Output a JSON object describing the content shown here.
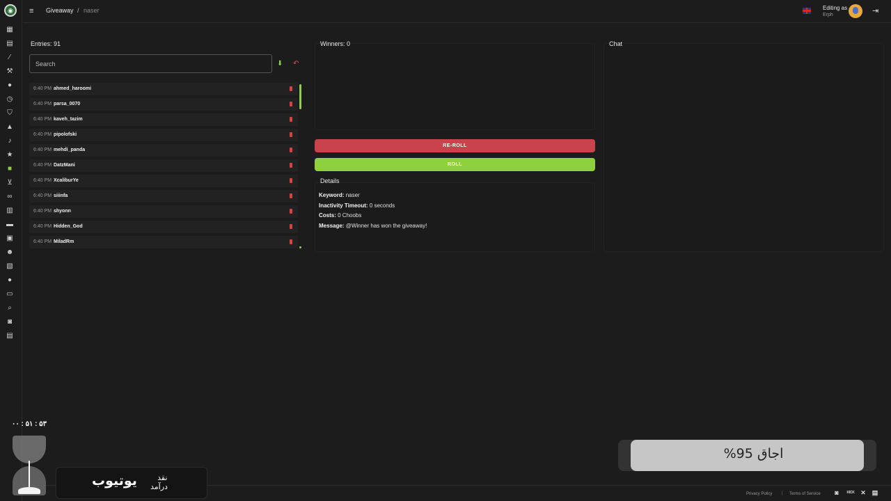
{
  "header": {
    "breadcrumb_main": "Giveaway",
    "breadcrumb_sep": "/",
    "breadcrumb_current": "naser",
    "editing_label": "Editing as",
    "editing_user": "Erph"
  },
  "sidebar": {
    "logo_icon": "channel-logo-icon",
    "items": [
      {
        "icon": "dashboard-icon",
        "glyph": "▦"
      },
      {
        "icon": "document-icon",
        "glyph": "▤"
      },
      {
        "icon": "wand-icon",
        "glyph": "⁄"
      },
      {
        "icon": "hammer-icon",
        "glyph": "⚒"
      },
      {
        "icon": "chat-bubble-icon",
        "glyph": "●"
      },
      {
        "icon": "clock-icon",
        "glyph": "◷"
      },
      {
        "icon": "shield-icon",
        "glyph": "⛉"
      },
      {
        "icon": "warning-icon",
        "glyph": "▲"
      },
      {
        "icon": "music-icon",
        "glyph": "♪"
      },
      {
        "icon": "star-icon",
        "glyph": "★"
      },
      {
        "icon": "gift-icon",
        "glyph": "■",
        "active": true
      },
      {
        "icon": "cart-icon",
        "glyph": "⊻"
      },
      {
        "icon": "link-icon",
        "glyph": "∞"
      },
      {
        "icon": "stats-icon",
        "glyph": "▥"
      },
      {
        "icon": "video-icon",
        "glyph": "▬"
      },
      {
        "icon": "archive-icon",
        "glyph": "▣"
      },
      {
        "icon": "smile-icon",
        "glyph": "☻"
      },
      {
        "icon": "film-icon",
        "glyph": "▧"
      },
      {
        "icon": "message-icon",
        "glyph": "●"
      },
      {
        "icon": "monitor-icon",
        "glyph": "▭"
      },
      {
        "icon": "search-icon",
        "glyph": "⌕"
      },
      {
        "icon": "discord-icon",
        "glyph": "◙"
      },
      {
        "icon": "id-card-icon",
        "glyph": "▤"
      }
    ]
  },
  "entries": {
    "title": "Entries: 91",
    "search_placeholder": "Search",
    "list": [
      {
        "time": "6:40 PM",
        "name": "ahmed_haroomi"
      },
      {
        "time": "6:40 PM",
        "name": "parsa_0070"
      },
      {
        "time": "6:40 PM",
        "name": "kaveh_tazim"
      },
      {
        "time": "6:40 PM",
        "name": "pipolofski"
      },
      {
        "time": "6:40 PM",
        "name": "mehdi_panda"
      },
      {
        "time": "6:40 PM",
        "name": "DatzMani"
      },
      {
        "time": "6:40 PM",
        "name": "XcaliburYe"
      },
      {
        "time": "6:40 PM",
        "name": "siiinfa"
      },
      {
        "time": "6:40 PM",
        "name": "shyonn"
      },
      {
        "time": "6:40 PM",
        "name": "Hidden_God"
      },
      {
        "time": "6:40 PM",
        "name": "MiladRm"
      }
    ]
  },
  "winners": {
    "title": "Winners: 0",
    "reroll_label": "RE-ROLL",
    "roll_label": "ROLL"
  },
  "details": {
    "title": "Details",
    "keyword_label": "Keyword:",
    "keyword_value": "naser",
    "timeout_label": "Inactivity Timeout:",
    "timeout_value": "0 seconds",
    "costs_label": "Costs:",
    "costs_value": "0 Choobs",
    "message_label": "Message:",
    "message_value": "@Winner has won the giveaway!"
  },
  "chat": {
    "title": "Chat"
  },
  "footer": {
    "privacy": "Privacy Policy",
    "sep": "|",
    "terms": "Terms of Service",
    "kick_label": "KICK"
  },
  "overlay": {
    "timer": "۰۰ : ۵۱ : ۵۳",
    "yt_main": "یوتیوب",
    "yt_sub1": "نقد",
    "yt_sub2": "درآمد",
    "progress_text": "اجاق 95%",
    "progress_value": 0.95
  },
  "colors": {
    "accent": "#8fd13c",
    "danger": "#c9434c",
    "background": "#1c1c1c"
  }
}
